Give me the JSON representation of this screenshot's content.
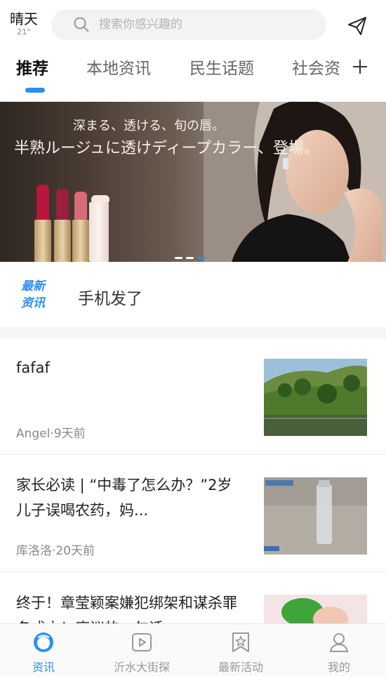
{
  "header": {
    "weather_condition": "晴天",
    "temperature": "21°",
    "search_placeholder": "搜索你感兴趣的"
  },
  "tabs": [
    {
      "label": "推荐",
      "active": true
    },
    {
      "label": "本地资讯",
      "active": false
    },
    {
      "label": "民生话题",
      "active": false
    },
    {
      "label": "社会资",
      "active": false
    }
  ],
  "banner": {
    "line1": "深まる、透ける、旬の唇。",
    "line2": "半熟ルージュに透けディープカラー、登場。",
    "slide_count": 3,
    "active_slide": 3
  },
  "latest_news": {
    "logo_line1": "最新",
    "logo_line2": "资讯",
    "text": "手机发了"
  },
  "feed": [
    {
      "title": "fafaf",
      "meta": "Angel·9天前",
      "thumb": "landscape-photo"
    },
    {
      "title": "家长必读 | “中毒了怎么办？”2岁儿子误喝农药，妈...",
      "meta": "库洛洛·20天前",
      "thumb": "bottle-photo"
    },
    {
      "title": "终于！章莹颖案嫌犯绑架和谋杀罪名成立！庭议的一句话",
      "meta": "",
      "thumb": "pepper-photo"
    }
  ],
  "bottom_nav": [
    {
      "label": "资讯",
      "icon": "news-icon",
      "active": true
    },
    {
      "label": "沂水大街探",
      "icon": "video-icon",
      "active": false
    },
    {
      "label": "最新活动",
      "icon": "activity-icon",
      "active": false
    },
    {
      "label": "我的",
      "icon": "profile-icon",
      "active": false
    }
  ],
  "colors": {
    "accent": "#2b8ff0",
    "inactive": "#999999",
    "background": "#ffffff"
  }
}
